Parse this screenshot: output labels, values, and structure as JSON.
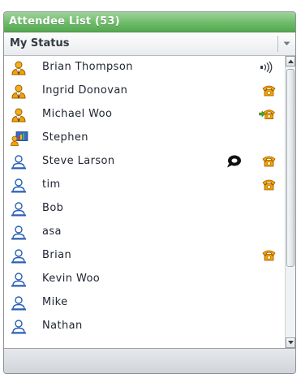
{
  "panel": {
    "title": "Attendee List (53)",
    "status_label": "My Status"
  },
  "colors": {
    "title_bar": "#6dbb68",
    "presenter_icon": "#e8a000",
    "attendee_icon": "#2a5fb4",
    "phone_icon": "#f3a300"
  },
  "attendees": [
    {
      "name": "Brian Thompson",
      "role": "presenter-icon",
      "activity": "speaking-icon"
    },
    {
      "name": "Ingrid Donovan",
      "role": "presenter-icon",
      "activity": "phone-icon"
    },
    {
      "name": "Michael  Woo",
      "role": "presenter-icon",
      "activity": "phone-transfer-icon"
    },
    {
      "name": "Stephen",
      "role": "desktop-sharing-icon",
      "activity": ""
    },
    {
      "name": "Steve Larson",
      "role": "attendee-icon",
      "activity": "chat-bubble-icon, phone-icon"
    },
    {
      "name": "tim",
      "role": "attendee-icon",
      "activity": "phone-icon"
    },
    {
      "name": "Bob",
      "role": "attendee-icon",
      "activity": ""
    },
    {
      "name": "asa",
      "role": "attendee-icon",
      "activity": ""
    },
    {
      "name": "Brian",
      "role": "attendee-icon",
      "activity": "phone-icon"
    },
    {
      "name": "Kevin Woo",
      "role": "attendee-icon",
      "activity": ""
    },
    {
      "name": "Mike",
      "role": "attendee-icon",
      "activity": ""
    },
    {
      "name": "Nathan",
      "role": "attendee-icon",
      "activity": ""
    }
  ]
}
